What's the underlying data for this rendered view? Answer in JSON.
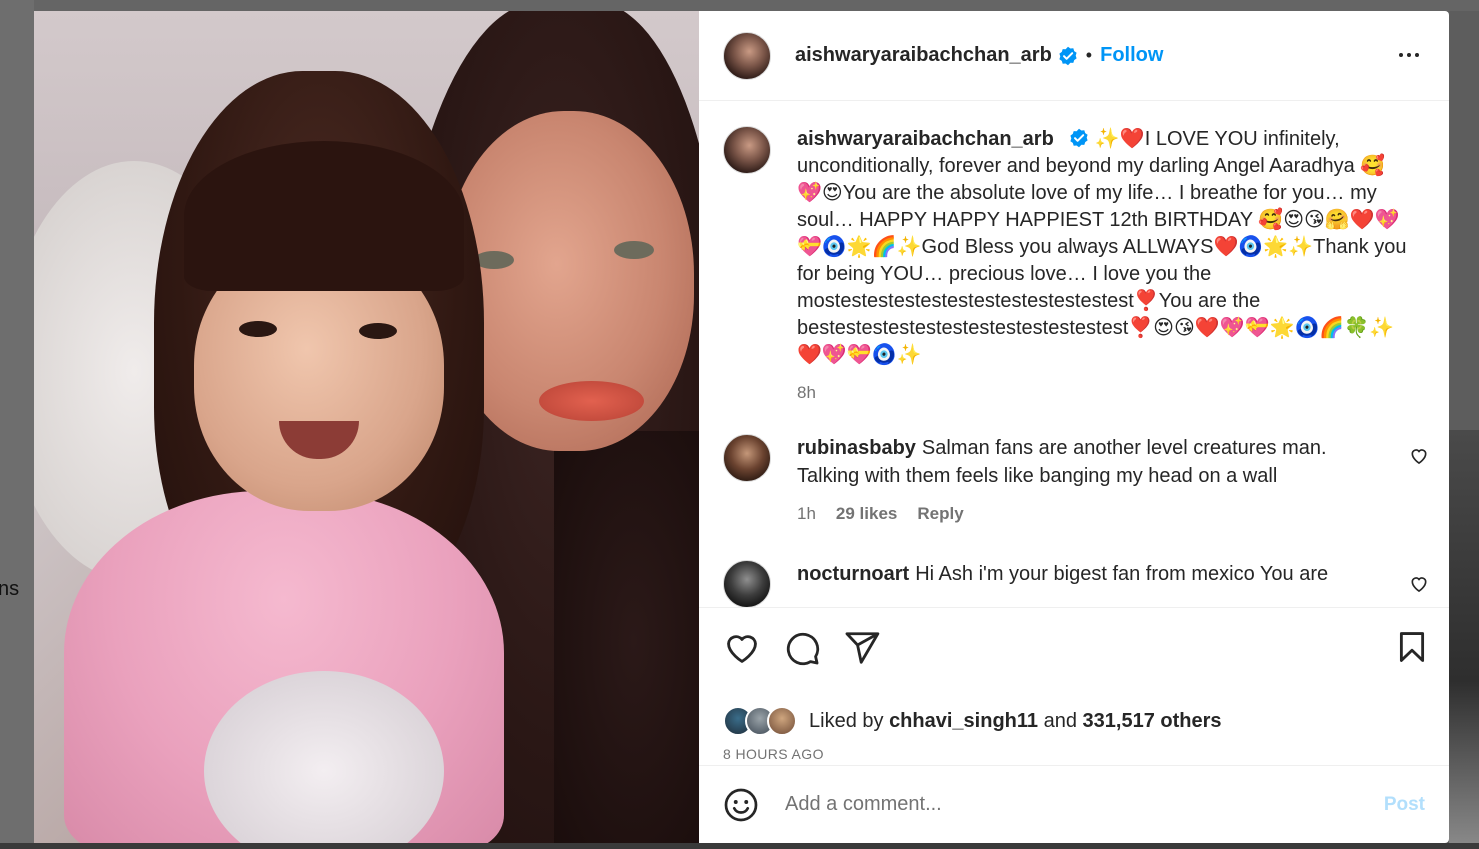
{
  "background": {
    "side_text": "ns"
  },
  "post": {
    "username": "aishwaryaraibachchan_arb",
    "follow_label": "Follow",
    "separator": "•",
    "caption": "✨❤️I LOVE YOU infinitely, unconditionally, forever and beyond my darling Angel Aaradhya 🥰💖😍You are the absolute love of my life… I breathe for you… my soul… HAPPY HAPPY HAPPIEST 12th BIRTHDAY 🥰😍😘🤗❤️💖💝🧿🌟🌈✨God Bless you always ALLWAYS❤️🧿🌟✨Thank you for being YOU… precious love… I love you the mostestestestestestestestestestestest❣️You are the bestestestestestestestestestestestest❣️😍😘❤️💖💝🌟🧿🌈🍀✨❤️💖💝🧿✨",
    "caption_time": "8h",
    "comments": [
      {
        "username": "rubinasbaby",
        "text": "Salman fans are another level creatures man. Talking with them feels like banging my head on a wall",
        "time": "1h",
        "likes": "29 likes",
        "reply": "Reply"
      },
      {
        "username": "nocturnoart",
        "text": "Hi Ash i'm your bigest fan from mexico You are",
        "time": "",
        "likes": "",
        "reply": ""
      }
    ],
    "liked_by_prefix": "Liked by",
    "liked_by_user": "chhavi_singh11",
    "liked_by_and": "and",
    "liked_by_others": "331,517 others",
    "posted_ago": "8 HOURS AGO",
    "add_comment_placeholder": "Add a comment...",
    "post_label": "Post"
  },
  "colors": {
    "link": "#0095f6",
    "post_disabled": "#b2dffc",
    "verified": "#0095f6"
  }
}
